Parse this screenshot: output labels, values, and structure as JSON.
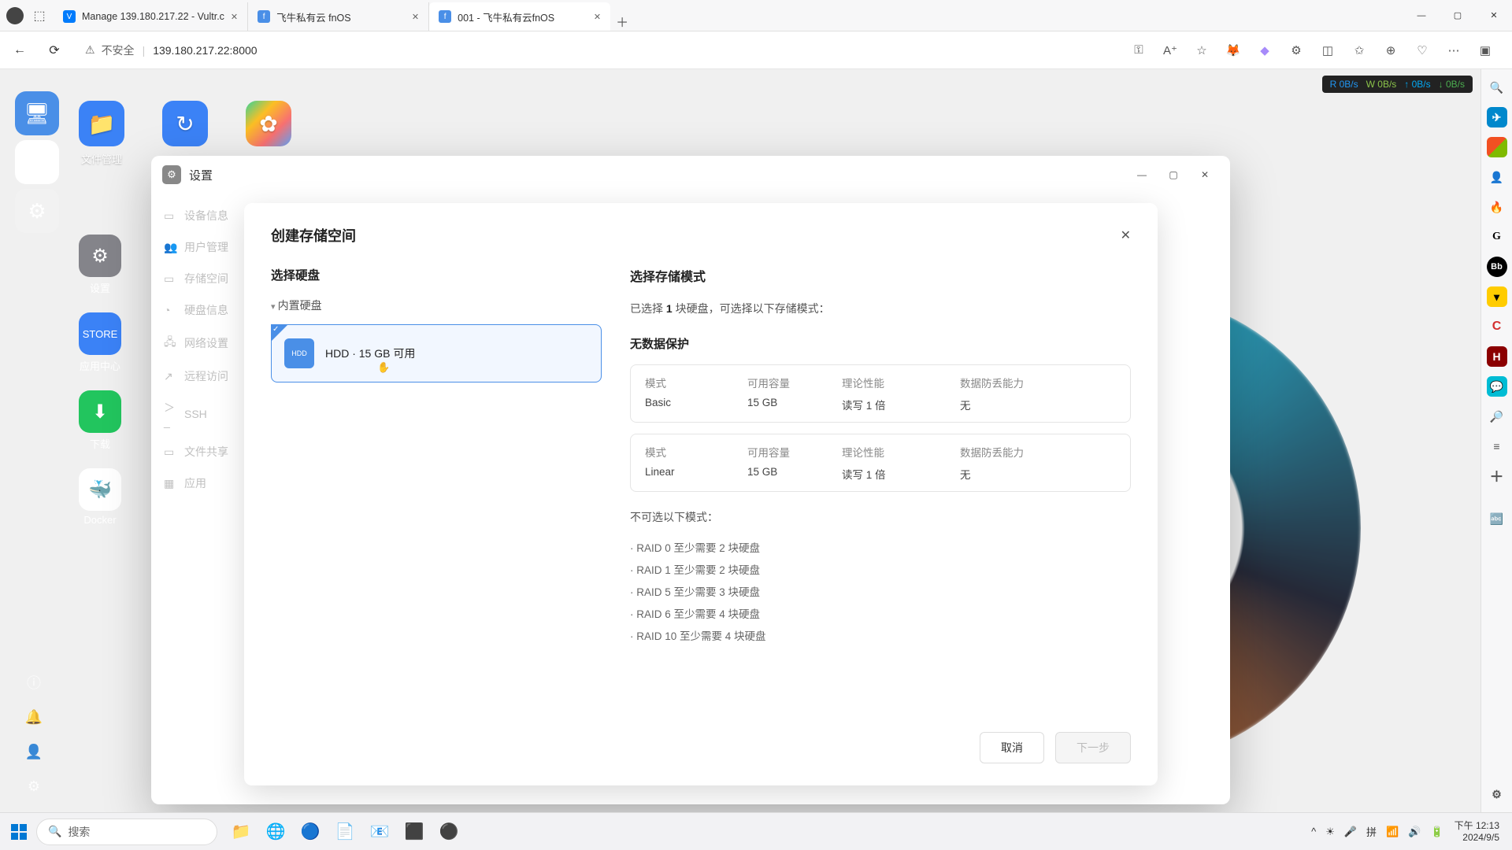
{
  "browser": {
    "tabs": [
      {
        "title": "Manage 139.180.217.22 - Vultr.c",
        "favicon": "V"
      },
      {
        "title": "飞牛私有云 fnOS",
        "favicon": "f"
      },
      {
        "title": "001 - 飞牛私有云fnOS",
        "favicon": "f"
      }
    ],
    "address_warn": "不安全",
    "url": "139.180.217.22:8000"
  },
  "net_stats": {
    "r": "R 0B/s",
    "w": "W 0B/s",
    "u": "↑ 0B/s",
    "d": "↓ 0B/s"
  },
  "desktop": {
    "files": "文件管理",
    "left_apps": {
      "settings": "设置",
      "store": "应用中心",
      "download": "下载",
      "docker": "Docker"
    }
  },
  "settings_window": {
    "title": "设置"
  },
  "sidebar": {
    "items": [
      "设备信息",
      "用户管理",
      "存储空间",
      "硬盘信息",
      "网络设置",
      "远程访问",
      "SSH",
      "文件共享",
      "应用"
    ]
  },
  "dialog": {
    "title": "创建存储空间",
    "select_disk": "选择硬盘",
    "internal_disk": "内置硬盘",
    "disk_label": "HDD · 15 GB 可用",
    "select_mode": "选择存储模式",
    "selected_desc_pre": "已选择 ",
    "selected_count": "1",
    "selected_desc_post": " 块硬盘，可选择以下存储模式：",
    "no_protect": "无数据保护",
    "headers": {
      "mode": "模式",
      "capacity": "可用容量",
      "perf": "理论性能",
      "protect": "数据防丢能力"
    },
    "modes": [
      {
        "name": "Basic",
        "capacity": "15 GB",
        "perf": "读写 1 倍",
        "protect": "无"
      },
      {
        "name": "Linear",
        "capacity": "15 GB",
        "perf": "读写 1 倍",
        "protect": "无"
      }
    ],
    "unavail": "不可选以下模式：",
    "raid": [
      "· RAID 0  至少需要 2 块硬盘",
      "· RAID 1  至少需要 2 块硬盘",
      "· RAID 5  至少需要 3 块硬盘",
      "· RAID 6  至少需要 4 块硬盘",
      "· RAID 10  至少需要 4 块硬盘"
    ],
    "cancel": "取消",
    "next": "下一步"
  },
  "taskbar": {
    "search": "搜索",
    "time": "下午 12:13",
    "date": "2024/9/5"
  }
}
